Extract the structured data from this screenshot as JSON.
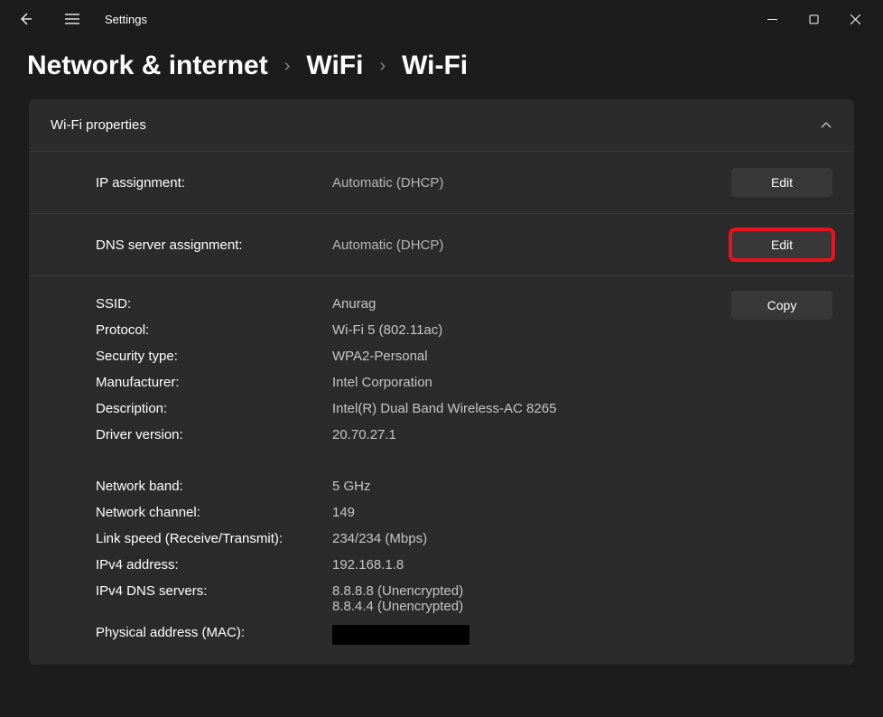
{
  "titlebar": {
    "app_title": "Settings"
  },
  "breadcrumb": {
    "level1": "Network & internet",
    "level2": "WiFi",
    "level3": "Wi-Fi"
  },
  "panel": {
    "title": "Wi-Fi properties",
    "ip_assignment": {
      "label": "IP assignment:",
      "value": "Automatic (DHCP)",
      "button": "Edit"
    },
    "dns_assignment": {
      "label": "DNS server assignment:",
      "value": "Automatic (DHCP)",
      "button": "Edit"
    },
    "copy_button": "Copy",
    "details": [
      {
        "label": "SSID:",
        "value": "Anurag"
      },
      {
        "label": "Protocol:",
        "value": "Wi-Fi 5 (802.11ac)"
      },
      {
        "label": "Security type:",
        "value": "WPA2-Personal"
      },
      {
        "label": "Manufacturer:",
        "value": "Intel Corporation"
      },
      {
        "label": "Description:",
        "value": "Intel(R) Dual Band Wireless-AC 8265"
      },
      {
        "label": "Driver version:",
        "value": "20.70.27.1"
      }
    ],
    "details2": [
      {
        "label": "Network band:",
        "value": "5 GHz"
      },
      {
        "label": "Network channel:",
        "value": "149"
      },
      {
        "label": "Link speed (Receive/Transmit):",
        "value": "234/234 (Mbps)"
      },
      {
        "label": "IPv4 address:",
        "value": "192.168.1.8"
      },
      {
        "label": "IPv4 DNS servers:",
        "value": "8.8.8.8 (Unencrypted)\n8.8.4.4 (Unencrypted)"
      },
      {
        "label": "Physical address (MAC):",
        "value": ""
      }
    ]
  }
}
